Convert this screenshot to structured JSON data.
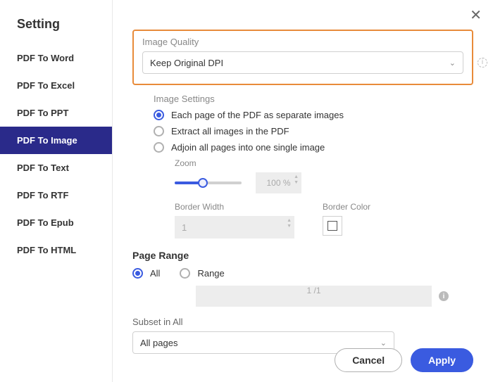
{
  "sidebar": {
    "title": "Setting",
    "items": [
      {
        "label": "PDF To Word",
        "active": false
      },
      {
        "label": "PDF To Excel",
        "active": false
      },
      {
        "label": "PDF To PPT",
        "active": false
      },
      {
        "label": "PDF To Image",
        "active": true
      },
      {
        "label": "PDF To Text",
        "active": false
      },
      {
        "label": "PDF To RTF",
        "active": false
      },
      {
        "label": "PDF To Epub",
        "active": false
      },
      {
        "label": "PDF To HTML",
        "active": false
      }
    ]
  },
  "imageQuality": {
    "label": "Image Quality",
    "value": "Keep Original DPI"
  },
  "imageSettings": {
    "label": "Image Settings",
    "options": [
      {
        "label": "Each page of the PDF as separate images",
        "checked": true
      },
      {
        "label": "Extract all images in the PDF",
        "checked": false
      },
      {
        "label": "Adjoin all pages into one single image",
        "checked": false
      }
    ],
    "zoom": {
      "label": "Zoom",
      "value": "100 %"
    },
    "borderWidth": {
      "label": "Border Width",
      "value": "1"
    },
    "borderColor": {
      "label": "Border Color"
    }
  },
  "pageRange": {
    "label": "Page Range",
    "options": [
      {
        "label": "All",
        "checked": true
      },
      {
        "label": "Range",
        "checked": false
      }
    ],
    "rangeValue": "1 /1"
  },
  "subset": {
    "label": "Subset in All",
    "value": "All pages"
  },
  "footer": {
    "cancel": "Cancel",
    "apply": "Apply"
  }
}
